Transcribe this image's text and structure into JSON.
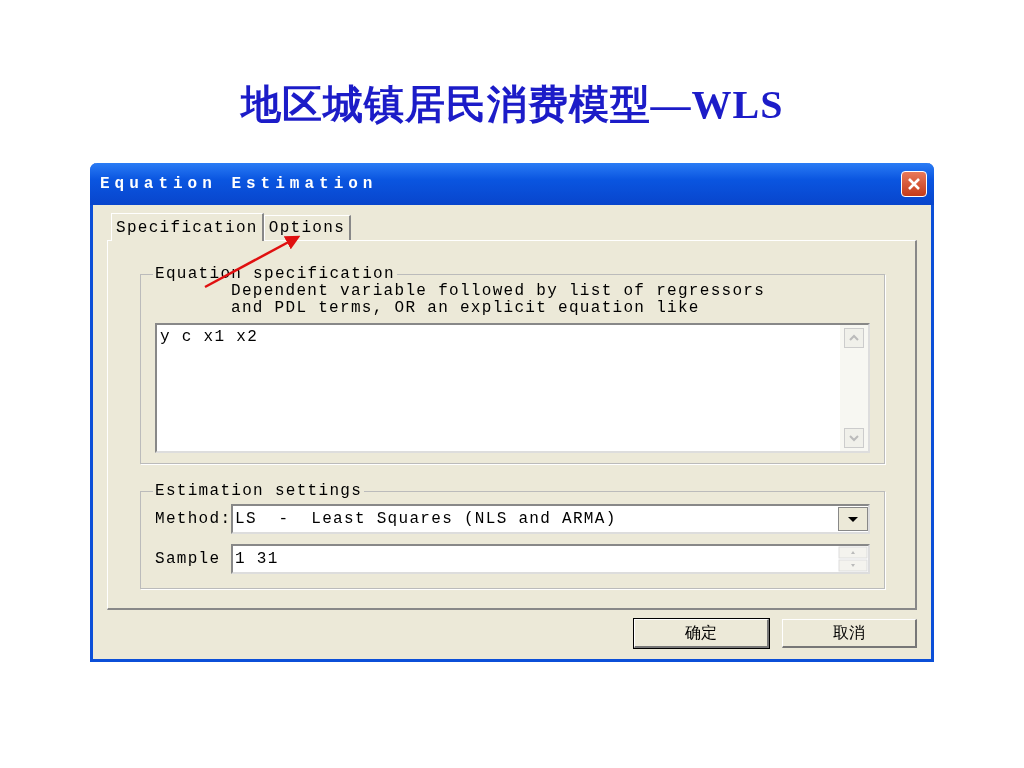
{
  "slide_title": "地区城镇居民消费模型—WLS",
  "window": {
    "title": "Equation Estimation"
  },
  "tabs": [
    {
      "label": "Specification",
      "selected": true
    },
    {
      "label": "Options",
      "selected": false
    }
  ],
  "equation_group": {
    "legend": "Equation specification",
    "hint_lines": [
      "Dependent variable followed by list of regressors",
      "and PDL terms, OR an explicit equation like"
    ],
    "value": "y c x1 x2"
  },
  "settings_group": {
    "legend": "Estimation settings",
    "method": {
      "label": "Method:",
      "value": "LS  -  Least Squares (NLS and ARMA)"
    },
    "sample": {
      "label": "Sample",
      "value": "1 31"
    }
  },
  "buttons": [
    "确定",
    "取消"
  ]
}
